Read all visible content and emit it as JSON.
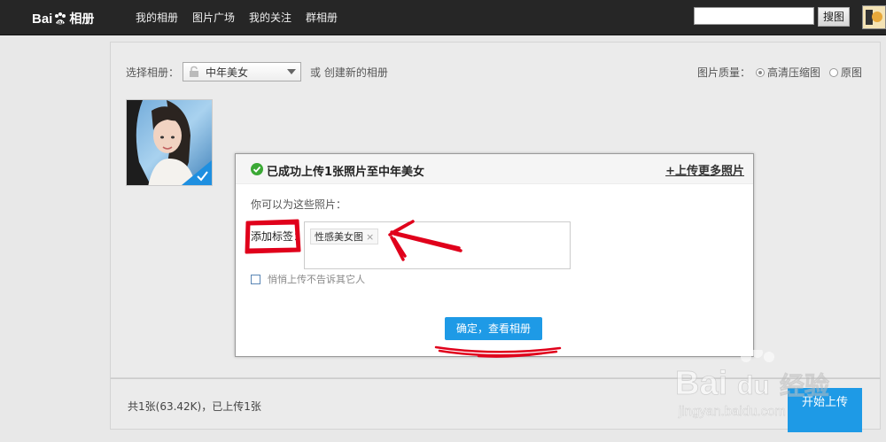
{
  "topbar": {
    "logo_text_a": "Bai",
    "logo_text_b": "相册",
    "nav": [
      "我的相册",
      "图片广场",
      "我的关注",
      "群相册"
    ],
    "search_placeholder": "",
    "search_button": "搜图"
  },
  "main": {
    "album_label": "选择相册：",
    "album_selected": "中年美女",
    "or_create": "或 创建新的相册",
    "quality_label": "图片质量：",
    "quality_options": [
      {
        "label": "高清压缩图",
        "selected": true
      },
      {
        "label": "原图",
        "selected": false
      }
    ]
  },
  "dialog": {
    "title": "已成功上传1张照片至中年美女",
    "upload_more": "+上传更多照片",
    "subtitle": "你可以为这些照片：",
    "tag_label": "添加标签：",
    "tags": [
      "性感美女图"
    ],
    "quiet_upload": "悄悄上传不告诉其它人",
    "confirm": "确定，查看相册"
  },
  "footer": {
    "summary": "共1张(63.42K)，已上传1张",
    "start_upload": "开始上传"
  },
  "watermark": {
    "line1": "Bai",
    "line1b": "经验",
    "line2": "jingyan.baidu.com"
  },
  "colors": {
    "topbar": "#262626",
    "accent_blue": "#1e9ae6",
    "annotation_red": "#e0001b"
  }
}
